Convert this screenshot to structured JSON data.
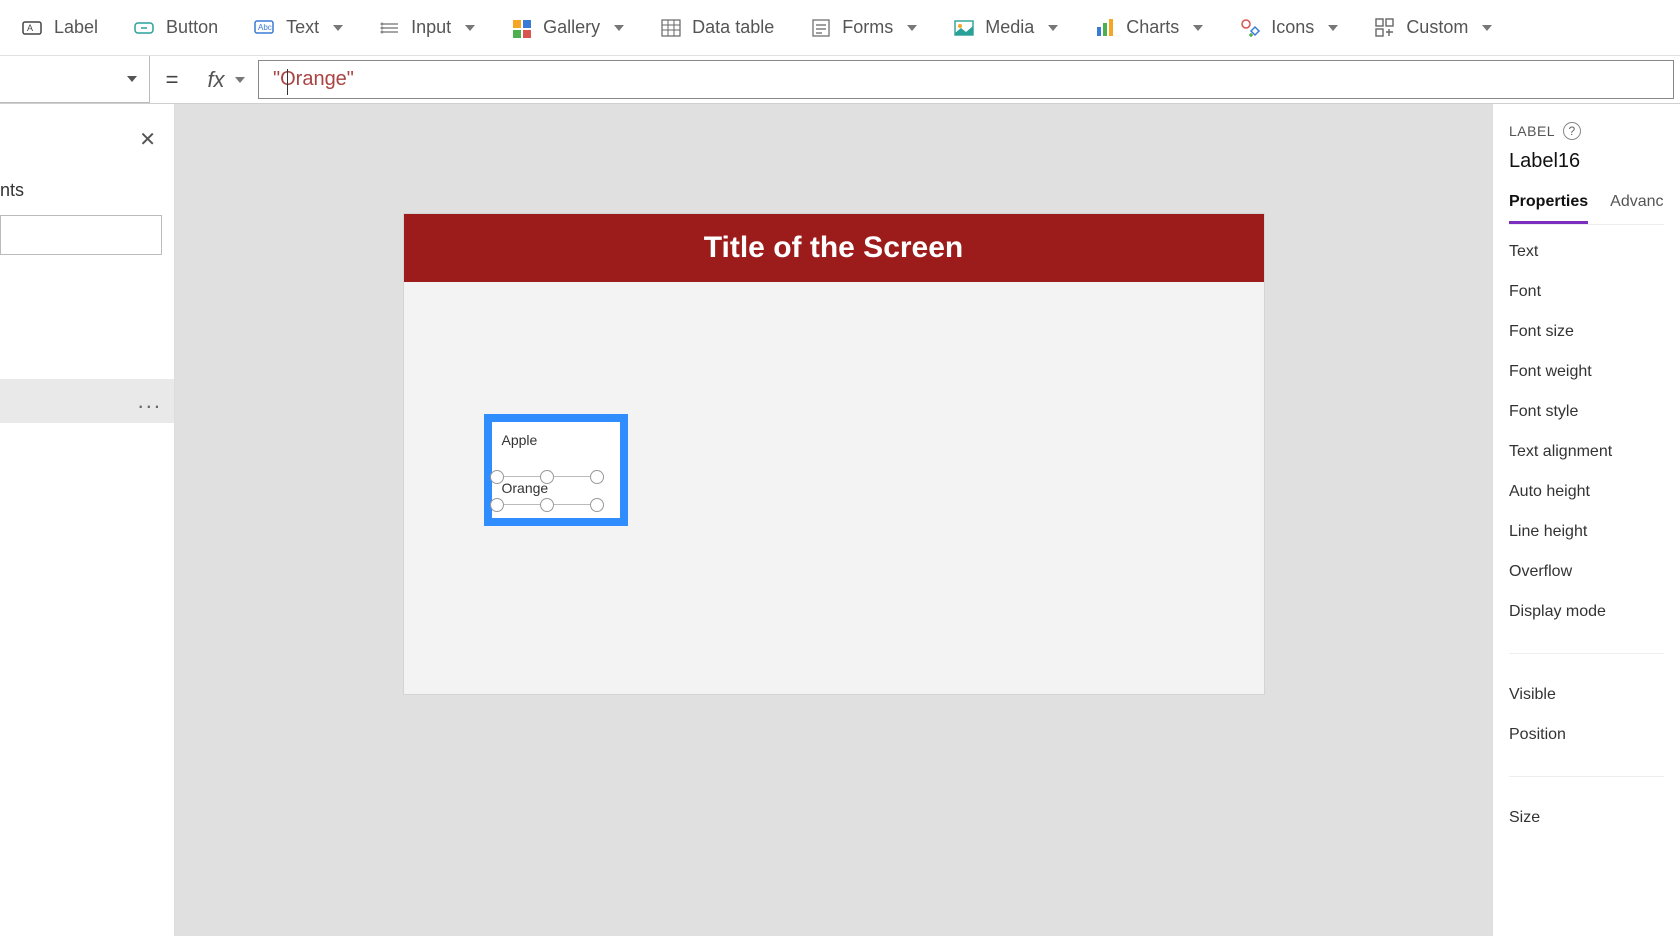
{
  "ribbon": {
    "label": "Label",
    "button": "Button",
    "text": "Text",
    "input": "Input",
    "gallery": "Gallery",
    "data_table": "Data table",
    "forms": "Forms",
    "media": "Media",
    "charts": "Charts",
    "icons": "Icons",
    "custom": "Custom"
  },
  "formula": {
    "equals": "=",
    "fx": "fx",
    "value": "\"Orange\""
  },
  "left": {
    "section_suffix": "nts",
    "dots": "..."
  },
  "canvas": {
    "title": "Title of the Screen",
    "options": [
      "Apple",
      "Orange"
    ]
  },
  "right": {
    "header": "LABEL",
    "control_name": "Label16",
    "tabs": {
      "properties": "Properties",
      "advanced": "Advanc"
    },
    "props": [
      "Text",
      "Font",
      "Font size",
      "Font weight",
      "Font style",
      "Text alignment",
      "Auto height",
      "Line height",
      "Overflow",
      "Display mode"
    ],
    "props2": [
      "Visible",
      "Position"
    ],
    "props3": [
      "Size"
    ]
  }
}
